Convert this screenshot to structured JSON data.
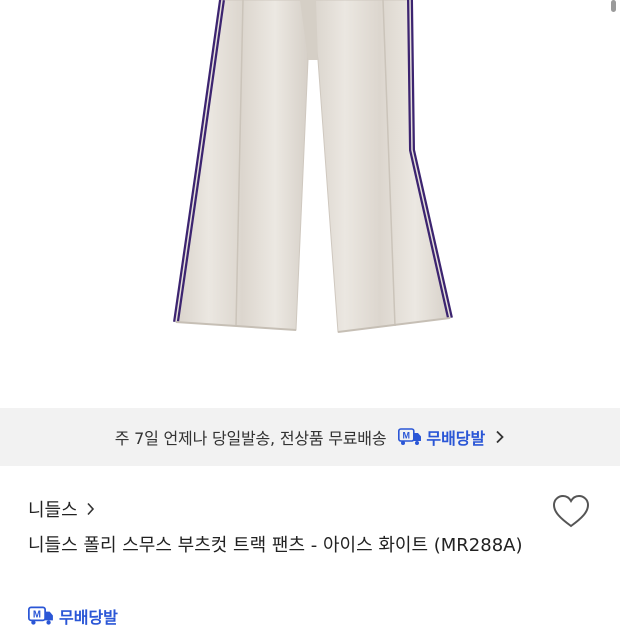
{
  "product_image": {
    "alt": "track pants image"
  },
  "shipping_banner": {
    "text": "주 7일 언제나 당일발송, 전상품 무료배송",
    "badge_label": "무배당발",
    "badge_icon": "truck-m-icon"
  },
  "product": {
    "brand": "니들스",
    "title": "니들스 폴리 스무스 부츠컷 트랙 팬츠 - 아이스 화이트 (MR288A)",
    "badge_label": "무배당발"
  },
  "colors": {
    "accent": "#2a56d6",
    "banner_bg": "#f2f2f2",
    "stripe": "#3c2470",
    "fabric": "#e6e1da"
  }
}
